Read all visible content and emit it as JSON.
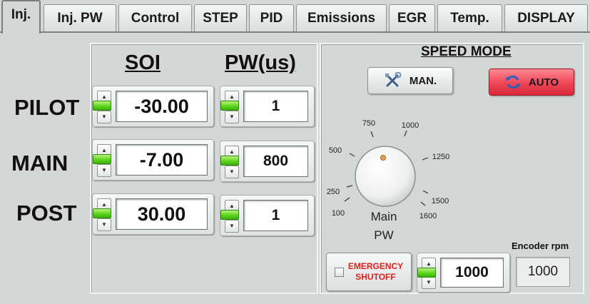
{
  "tabs": [
    {
      "label": "Inj.",
      "active": true
    },
    {
      "label": "Inj. PW",
      "active": false
    },
    {
      "label": "Control",
      "active": false
    },
    {
      "label": "STEP",
      "active": false
    },
    {
      "label": "PID",
      "active": false
    },
    {
      "label": "Emissions",
      "active": false
    },
    {
      "label": "EGR",
      "active": false
    },
    {
      "label": "Temp.",
      "active": false
    },
    {
      "label": "DISPLAY",
      "active": false
    }
  ],
  "injection": {
    "headers": {
      "soi": "SOI",
      "pw": "PW(us)"
    },
    "rows": [
      {
        "label": "PILOT",
        "soi": "-30.00",
        "pw": "1"
      },
      {
        "label": "MAIN",
        "soi": "-7.00",
        "pw": "800"
      },
      {
        "label": "POST",
        "soi": "30.00",
        "pw": "1"
      }
    ]
  },
  "speed_mode": {
    "title": "SPEED MODE",
    "man_label": "MAN.",
    "auto_label": "AUTO",
    "active_mode": "AUTO",
    "knob": {
      "title_line1": "Main",
      "title_line2": "PW",
      "ticks": [
        "100",
        "250",
        "500",
        "750",
        "1000",
        "1250",
        "1500",
        "1600"
      ]
    },
    "emergency_line1": "EMERGENCY",
    "emergency_line2": "SHUTOFF",
    "rpm_set": "1000",
    "encoder_label": "Encoder rpm",
    "encoder_value": "1000"
  },
  "colors": {
    "background": "#d4d7d6",
    "led_green": "#5dd61c",
    "auto_red": "#f04a5a",
    "emergency_text": "#e02020"
  },
  "icons": {
    "man": "tools-icon",
    "auto": "refresh-icon"
  }
}
